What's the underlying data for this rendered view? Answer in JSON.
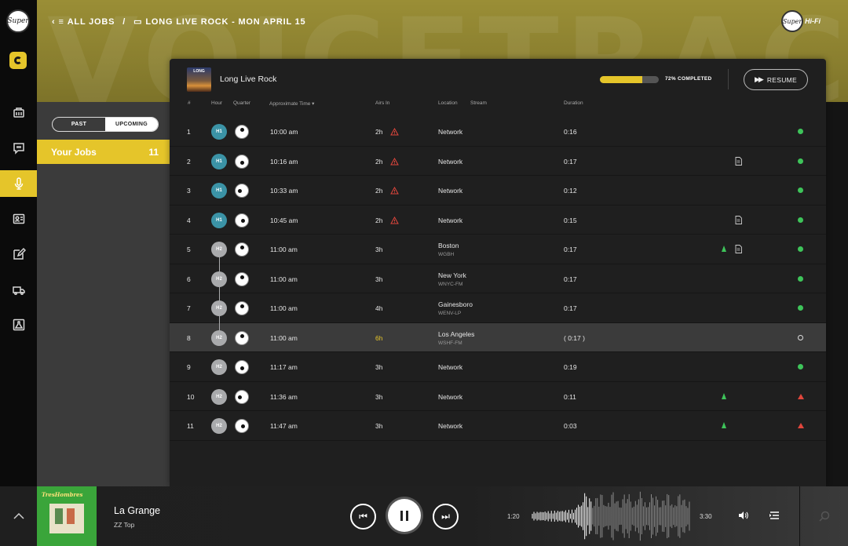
{
  "breadcrumb": {
    "all_jobs": "ALL JOBS",
    "separator": "/",
    "current": "LONG LIVE ROCK - MON APRIL 15"
  },
  "brand": {
    "logo_text": "Super",
    "suffix": "Hi-Fi"
  },
  "hero_watermark": "VOICETRACK",
  "rail": {
    "logo_text": "Super",
    "items": [
      "dashboard-icon",
      "chat-icon",
      "microphone-icon",
      "contacts-icon",
      "edit-icon",
      "truck-icon",
      "lab-flask-icon"
    ],
    "active": "microphone-icon"
  },
  "sidebar": {
    "segments": {
      "past": "PAST",
      "upcoming": "UPCOMING"
    },
    "your_jobs": {
      "label": "Your Jobs",
      "count": "11"
    }
  },
  "job": {
    "cover_text": "LONG",
    "title": "Long Live Rock",
    "progress_fraction": 0.72,
    "progress_label": "72% COMPLETED",
    "resume_label": "RESUME"
  },
  "columns": {
    "num": "#",
    "hour": "Hour",
    "quarter": "Quarter",
    "time": "Approximate Time ▾",
    "airs": "Airs In",
    "location": "Location",
    "stream": "Stream",
    "duration": "Duration"
  },
  "rows": [
    {
      "num": "1",
      "hour": "H1",
      "quarter": "0",
      "time": "10:00 am",
      "airs": "2h",
      "warn": true,
      "location": "Network",
      "stream": "",
      "duration": "0:16",
      "doc": false,
      "up": false,
      "status": "ok"
    },
    {
      "num": "2",
      "hour": "H1",
      "quarter": "1",
      "time": "10:16 am",
      "airs": "2h",
      "warn": true,
      "location": "Network",
      "stream": "",
      "duration": "0:17",
      "doc": true,
      "up": false,
      "status": "ok"
    },
    {
      "num": "3",
      "hour": "H1",
      "quarter": "2",
      "time": "10:33 am",
      "airs": "2h",
      "warn": true,
      "location": "Network",
      "stream": "",
      "duration": "0:12",
      "doc": false,
      "up": false,
      "status": "ok"
    },
    {
      "num": "4",
      "hour": "H1",
      "quarter": "3",
      "time": "10:45 am",
      "airs": "2h",
      "warn": true,
      "location": "Network",
      "stream": "",
      "duration": "0:15",
      "doc": true,
      "up": false,
      "status": "ok"
    },
    {
      "num": "5",
      "hour": "H2",
      "quarter": "0",
      "time": "11:00 am",
      "airs": "3h",
      "warn": false,
      "location": "Boston",
      "stream": "WGBH",
      "duration": "0:17",
      "doc": true,
      "up": true,
      "status": "ok"
    },
    {
      "num": "6",
      "hour": "H2",
      "quarter": "0",
      "time": "11:00 am",
      "airs": "3h",
      "warn": false,
      "location": "New York",
      "stream": "WNYC-FM",
      "duration": "0:17",
      "doc": false,
      "up": false,
      "status": "ok"
    },
    {
      "num": "7",
      "hour": "H2",
      "quarter": "0",
      "time": "11:00 am",
      "airs": "4h",
      "warn": false,
      "location": "Gainesboro",
      "stream": "WENV-LP",
      "duration": "0:17",
      "doc": false,
      "up": false,
      "status": "ok"
    },
    {
      "num": "8",
      "hour": "H2",
      "quarter": "0",
      "time": "11:00 am",
      "airs": "6h",
      "warn": false,
      "late": true,
      "location": "Los Angeles",
      "stream": "WSHF-FM",
      "duration": "( 0:17 )",
      "doc": false,
      "up": false,
      "status": "pending",
      "selected": true
    },
    {
      "num": "9",
      "hour": "H2",
      "quarter": "1",
      "time": "11:17 am",
      "airs": "3h",
      "warn": false,
      "location": "Network",
      "stream": "",
      "duration": "0:19",
      "doc": false,
      "up": false,
      "status": "ok"
    },
    {
      "num": "10",
      "hour": "H2",
      "quarter": "2",
      "time": "11:36 am",
      "airs": "3h",
      "warn": false,
      "location": "Network",
      "stream": "",
      "duration": "0:11",
      "doc": false,
      "up": true,
      "status": "alert"
    },
    {
      "num": "11",
      "hour": "H2",
      "quarter": "3",
      "time": "11:47 am",
      "airs": "3h",
      "warn": false,
      "location": "Network",
      "stream": "",
      "duration": "0:03",
      "doc": false,
      "up": true,
      "status": "alert"
    }
  ],
  "player": {
    "album_title_art": "TresHombres",
    "title": "La Grange",
    "artist": "ZZ Top",
    "current": "1:20",
    "duration": "3:30"
  },
  "colors": {
    "accent": "#e5c52a",
    "h1": "#3b93a6",
    "h2": "#a9aaac",
    "ok": "#3ec45a",
    "alert": "#e0463c"
  }
}
